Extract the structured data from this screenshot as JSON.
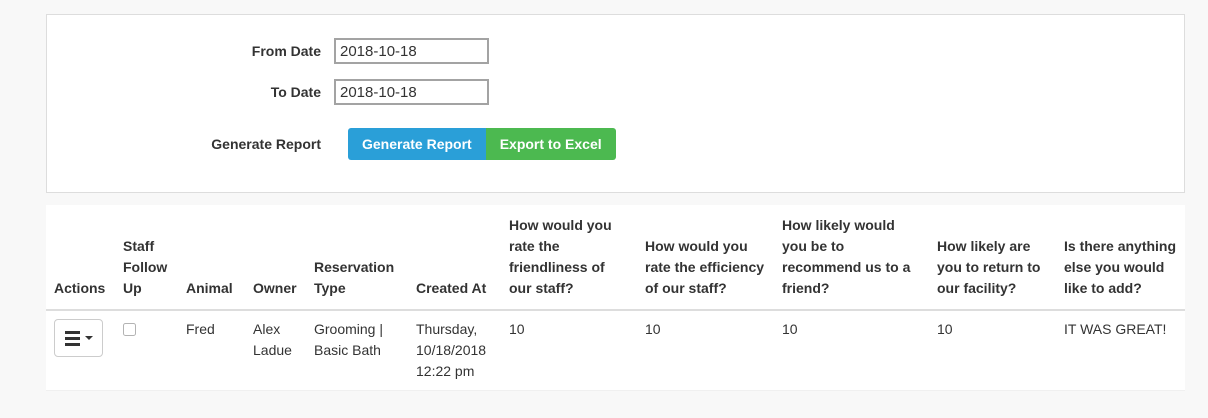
{
  "colors": {
    "primary_blue": "#2a9fd8",
    "success_green": "#4cb950"
  },
  "filter_form": {
    "from_date": {
      "label": "From Date",
      "value": "2018-10-18"
    },
    "to_date": {
      "label": "To Date",
      "value": "2018-10-18"
    },
    "generate_label": "Generate Report",
    "generate_button_label": "Generate Report",
    "export_button_label": "Export to Excel"
  },
  "table": {
    "columns": [
      {
        "label": "Actions"
      },
      {
        "label": "Staff Follow Up"
      },
      {
        "label": "Animal"
      },
      {
        "label": "Owner"
      },
      {
        "label": "Reservation Type"
      },
      {
        "label": "Created At"
      },
      {
        "label": "How would you rate the friendliness of our staff?"
      },
      {
        "label": "How would you rate the efficiency of our staff?"
      },
      {
        "label": "How likely would you be to recommend us to a friend?"
      },
      {
        "label": "How likely are you to return to our facility?"
      },
      {
        "label": "Is there anything else you would like to add?"
      }
    ],
    "rows": [
      {
        "staff_follow_up_checked": false,
        "animal": "Fred",
        "owner": "Alex Ladue",
        "reservation_type": "Grooming | Basic Bath",
        "created_at": "Thursday, 10/18/2018 12:22 pm",
        "q_friendliness": "10",
        "q_efficiency": "10",
        "q_recommend": "10",
        "q_return": "10",
        "q_anything_else": "IT WAS GREAT!"
      }
    ]
  }
}
